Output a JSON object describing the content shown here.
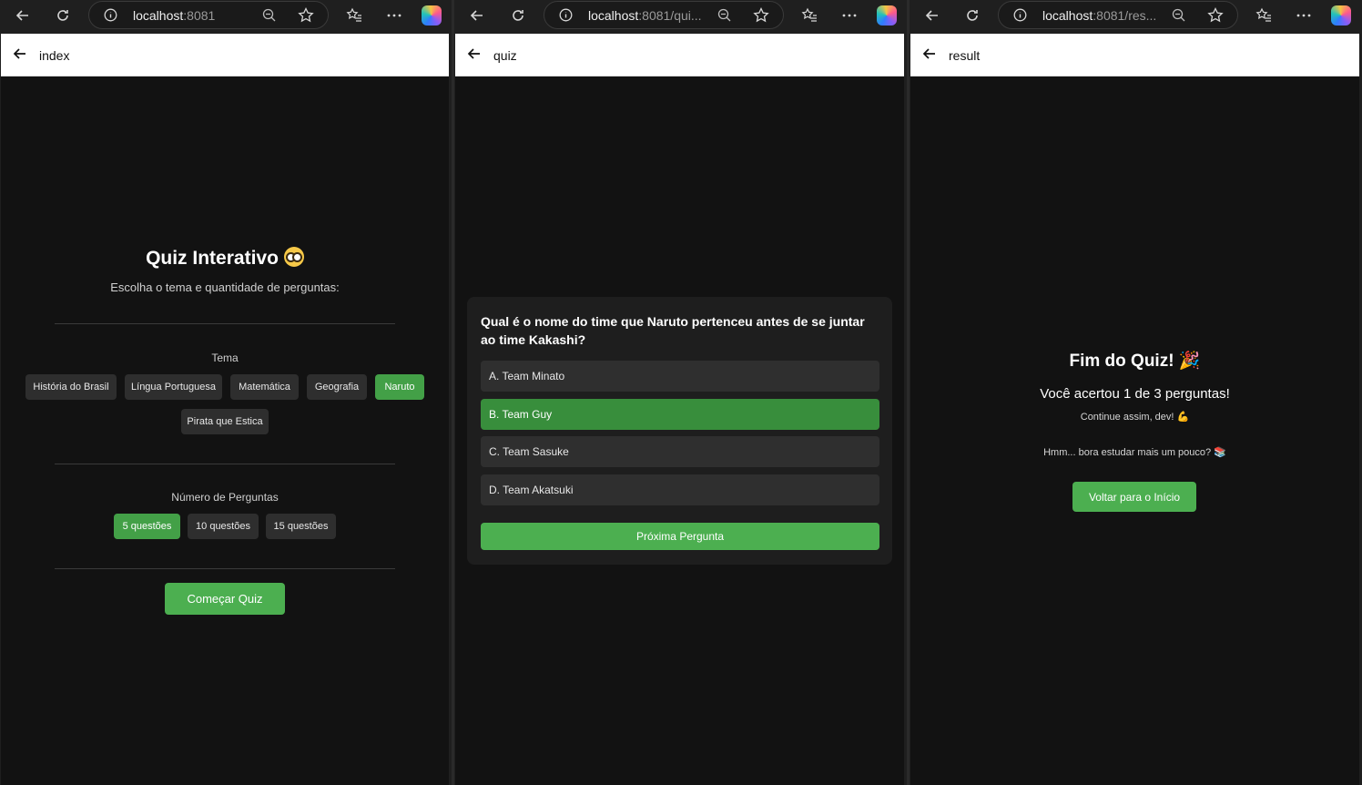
{
  "windows": [
    {
      "url_host": "localhost",
      "url_rest": ":8081",
      "appbar_title": "index"
    },
    {
      "url_host": "localhost",
      "url_rest": ":8081/qui...",
      "appbar_title": "quiz"
    },
    {
      "url_host": "localhost",
      "url_rest": ":8081/res...",
      "appbar_title": "result"
    }
  ],
  "index": {
    "title": "Quiz Interativo",
    "subtitle": "Escolha o tema e quantidade de perguntas:",
    "theme_label": "Tema",
    "themes": [
      "História do Brasil",
      "Língua Portuguesa",
      "Matemática",
      "Geografia",
      "Naruto",
      "Pirata que Estica"
    ],
    "selected_theme": "Naruto",
    "count_label": "Número de Perguntas",
    "counts": [
      "5 questões",
      "10 questões",
      "15 questões"
    ],
    "selected_count": "5 questões",
    "start_label": "Começar Quiz"
  },
  "quiz": {
    "question": "Qual é o nome do time que Naruto pertenceu antes de se juntar ao time Kakashi?",
    "options": [
      "A. Team Minato",
      "B. Team Guy",
      "C. Team Sasuke",
      "D. Team Akatsuki"
    ],
    "selected_option": "B. Team Guy",
    "next_label": "Próxima Pergunta"
  },
  "result": {
    "title": "Fim do Quiz! 🎉",
    "score": "Você acertou 1 de 3 perguntas!",
    "encouragement": "Continue assim, dev! 💪",
    "message": "Hmm... bora estudar mais um pouco? 📚",
    "home_label": "Voltar para o Início"
  },
  "colors": {
    "accent": "#4caf50",
    "selected_option": "#388e3c",
    "page_bg": "#121212",
    "chip_bg": "#2e2e2e"
  }
}
